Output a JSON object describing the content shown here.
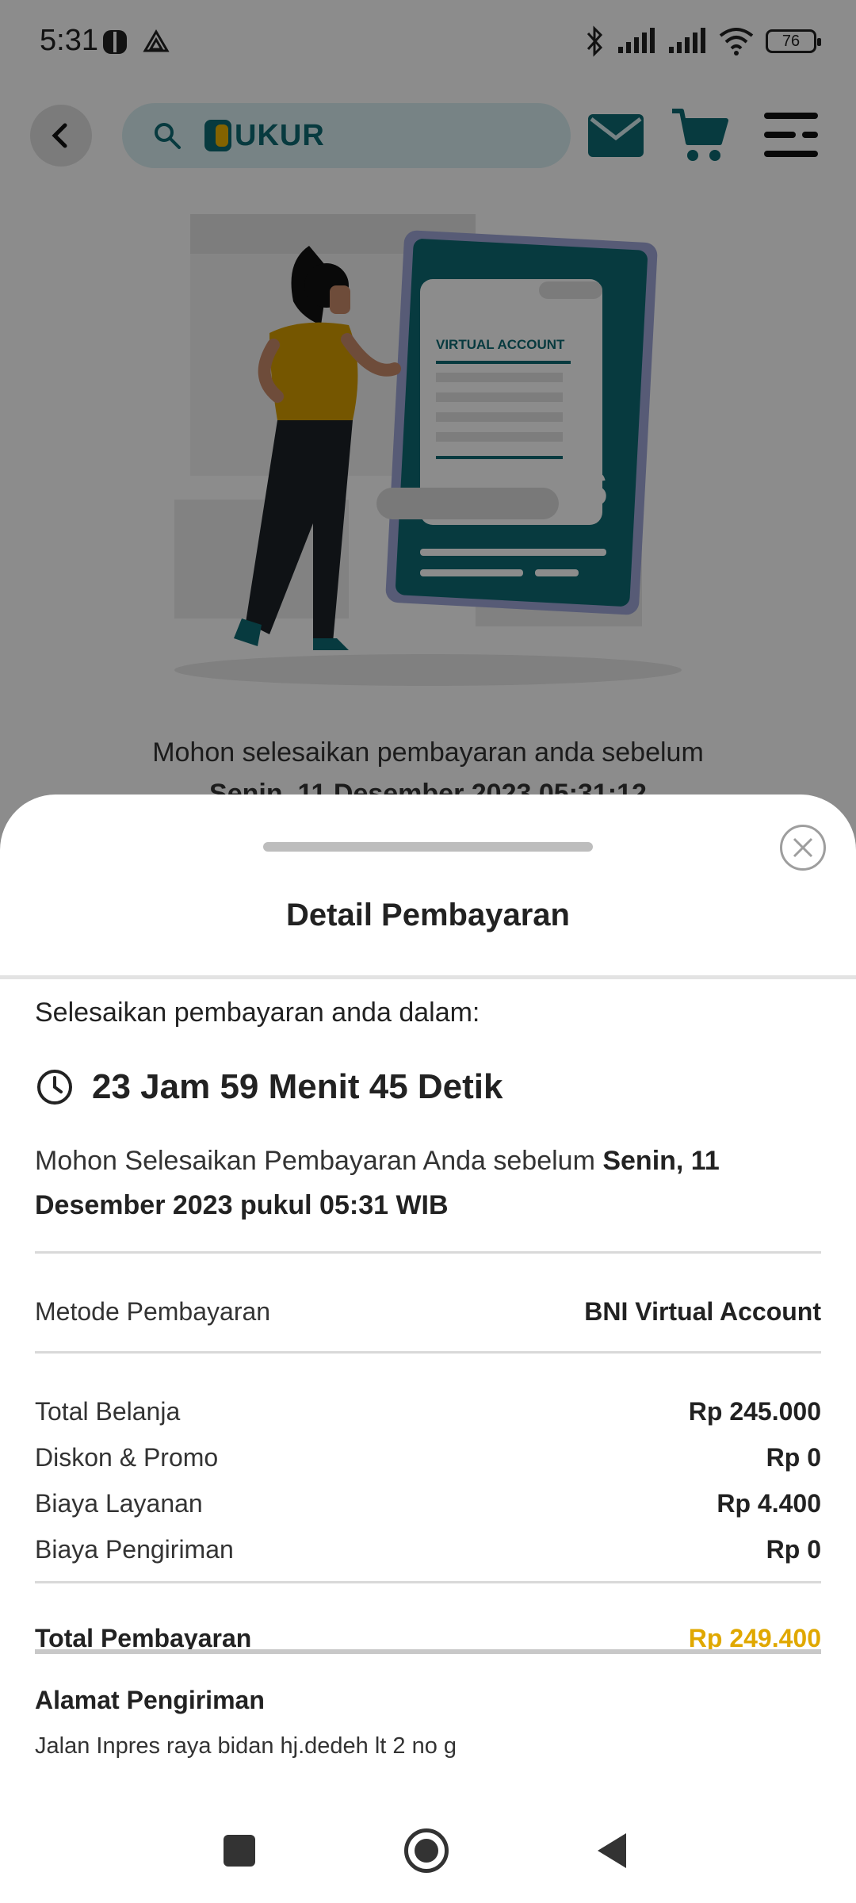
{
  "status_bar": {
    "time": "5:31",
    "battery": "76"
  },
  "header": {
    "logo_text": "UKUR"
  },
  "illustration": {
    "card_label": "VIRTUAL ACCOUNT",
    "currency_symbol": "$"
  },
  "background": {
    "message": "Mohon selesaikan pembayaran anda sebelum",
    "date": "Senin, 11 Desember 2023 05:31:12"
  },
  "sheet": {
    "title": "Detail Pembayaran",
    "countdown_label": "Selesaikan pembayaran anda dalam:",
    "countdown": "23 Jam 59 Menit 45 Detik",
    "deadline_prefix": "Mohon Selesaikan Pembayaran Anda sebelum ",
    "deadline_date": "Senin, 11 Desember 2023 pukul 05:31 WIB",
    "payment_method_label": "Metode Pembayaran",
    "payment_method_value": "BNI Virtual Account",
    "summary": [
      {
        "label": "Total Belanja",
        "value": "Rp 245.000"
      },
      {
        "label": "Diskon & Promo",
        "value": "Rp 0"
      },
      {
        "label": "Biaya Layanan",
        "value": "Rp 4.400"
      },
      {
        "label": "Biaya Pengiriman",
        "value": "Rp 0"
      }
    ],
    "total_label": "Total Pembayaran",
    "total_value": "Rp 249.400",
    "address_title": "Alamat Pengiriman",
    "address": "Jalan Inpres raya bidan hj.dedeh lt 2 no g"
  },
  "colors": {
    "brand": "#0d6b73",
    "accent": "#f1b500",
    "total": "#e0a800"
  },
  "icons": [
    "back-arrow-icon",
    "search-icon",
    "mail-icon",
    "cart-icon",
    "menu-icon",
    "close-icon",
    "clock-icon"
  ]
}
